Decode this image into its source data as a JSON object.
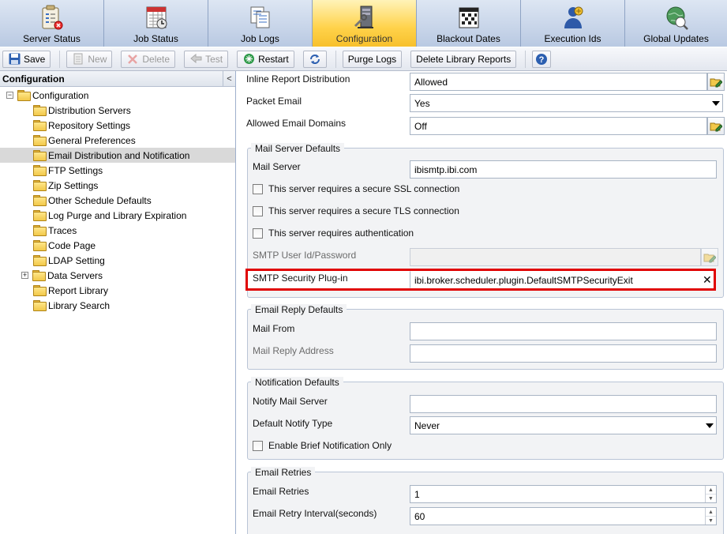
{
  "tabs": [
    {
      "label": "Server Status",
      "icon": "server-status-icon"
    },
    {
      "label": "Job Status",
      "icon": "job-status-icon"
    },
    {
      "label": "Job Logs",
      "icon": "job-logs-icon"
    },
    {
      "label": "Configuration",
      "icon": "configuration-icon",
      "active": true
    },
    {
      "label": "Blackout Dates",
      "icon": "calendar-icon"
    },
    {
      "label": "Execution Ids",
      "icon": "execution-ids-icon"
    },
    {
      "label": "Global Updates",
      "icon": "global-updates-icon"
    }
  ],
  "toolbar": {
    "save": "Save",
    "new": "New",
    "delete": "Delete",
    "test": "Test",
    "restart": "Restart",
    "purge_logs": "Purge Logs",
    "delete_library_reports": "Delete Library Reports"
  },
  "left": {
    "title": "Configuration",
    "collapse_glyph": "<",
    "tree": [
      {
        "label": "Configuration",
        "level": 0,
        "expander": "−"
      },
      {
        "label": "Distribution Servers",
        "level": 1
      },
      {
        "label": "Repository Settings",
        "level": 1
      },
      {
        "label": "General Preferences",
        "level": 1
      },
      {
        "label": "Email Distribution and Notification",
        "level": 1,
        "selected": true
      },
      {
        "label": "FTP Settings",
        "level": 1
      },
      {
        "label": "Zip Settings",
        "level": 1
      },
      {
        "label": "Other Schedule Defaults",
        "level": 1
      },
      {
        "label": "Log Purge and Library Expiration",
        "level": 1
      },
      {
        "label": "Traces",
        "level": 1
      },
      {
        "label": "Code Page",
        "level": 1
      },
      {
        "label": "LDAP Setting",
        "level": 1
      },
      {
        "label": "Data Servers",
        "level": 1,
        "expander": "+"
      },
      {
        "label": "Report Library",
        "level": 1
      },
      {
        "label": "Library Search",
        "level": 1
      }
    ]
  },
  "form": {
    "inline_report_distribution": {
      "label": "Inline Report Distribution",
      "value": "Allowed"
    },
    "packet_email": {
      "label": "Packet Email",
      "value": "Yes"
    },
    "allowed_email_domains": {
      "label": "Allowed Email Domains",
      "value": "Off"
    },
    "mail_server_defaults": {
      "legend": "Mail Server Defaults",
      "mail_server": {
        "label": "Mail Server",
        "value": "ibismtp.ibi.com"
      },
      "ssl": "This server requires a secure SSL connection",
      "tls": "This server requires a secure TLS connection",
      "auth": "This server requires authentication",
      "smtp_user": {
        "label": "SMTP User Id/Password",
        "value": ""
      },
      "smtp_plugin": {
        "label": "SMTP Security Plug-in",
        "value": "ibi.broker.scheduler.plugin.DefaultSMTPSecurityExit",
        "clear": "✕"
      }
    },
    "email_reply_defaults": {
      "legend": "Email Reply Defaults",
      "mail_from": {
        "label": "Mail From",
        "value": ""
      },
      "mail_reply": {
        "label": "Mail Reply Address",
        "value": ""
      }
    },
    "notification_defaults": {
      "legend": "Notification Defaults",
      "notify_server": {
        "label": "Notify Mail Server",
        "value": ""
      },
      "notify_type": {
        "label": "Default Notify Type",
        "value": "Never"
      },
      "brief": "Enable Brief Notification Only"
    },
    "email_retries": {
      "legend": "Email Retries",
      "retries": {
        "label": "Email Retries",
        "value": "1"
      },
      "interval": {
        "label": "Email Retry Interval(seconds)",
        "value": "60"
      }
    }
  },
  "colors": {
    "active_tab": "#ffd24a",
    "highlight_border": "#e00000",
    "selected_row": "#d9d9d9"
  }
}
